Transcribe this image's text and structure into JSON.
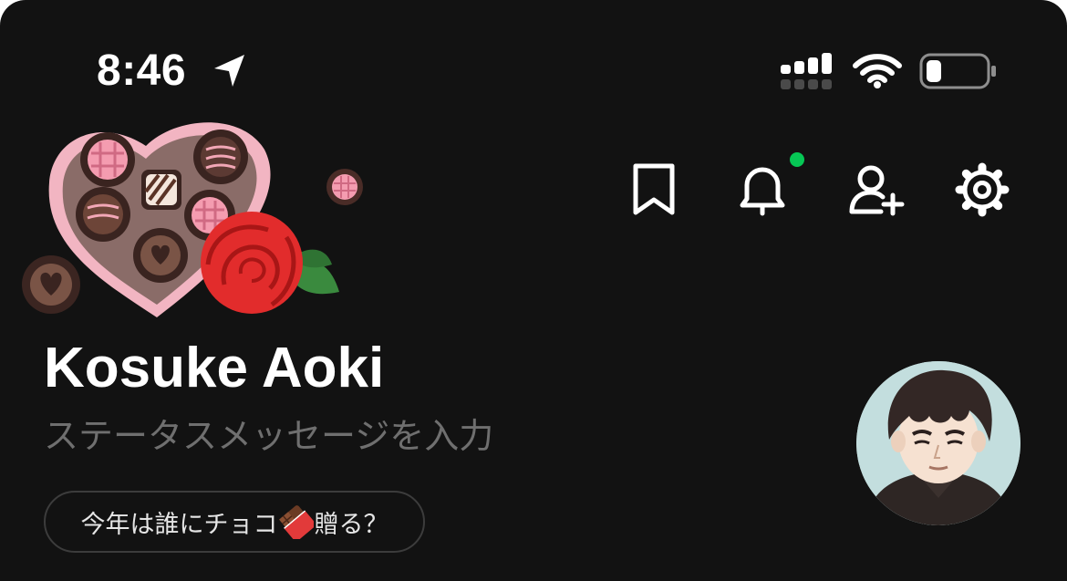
{
  "status_bar": {
    "time": "8:46",
    "icons": [
      "location-arrow-icon",
      "cellular-signal-icon",
      "wifi-icon",
      "battery-icon"
    ]
  },
  "header": {
    "actions": [
      "bookmark-icon",
      "bell-icon",
      "add-friend-icon",
      "gear-icon"
    ],
    "notification_dot_color": "#06c755"
  },
  "decoration": {
    "icons": [
      "heart-chocolate-box-icon",
      "rose-icon"
    ]
  },
  "profile": {
    "name": "Kosuke Aoki",
    "status_placeholder": "ステータスメッセージを入力",
    "prompt_before": "今年は誰にチョコ",
    "prompt_icon": "chocolate-bar-icon",
    "prompt_after": "贈る？"
  },
  "colors": {
    "background": "#121212",
    "text_primary": "#ffffff",
    "text_placeholder": "#6f6f6f",
    "pill_border": "#3c3c3c",
    "accent_green": "#06c755"
  }
}
